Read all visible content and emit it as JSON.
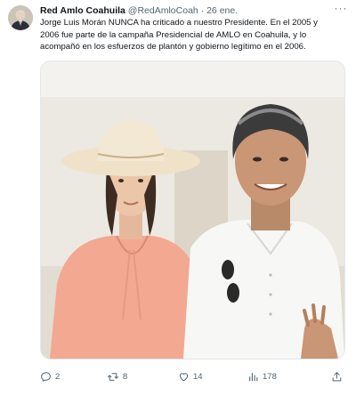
{
  "tweet": {
    "author_name": "Red Amlo Coahuila",
    "handle": "@RedAmloCoah",
    "separator": "·",
    "date": "26 ene.",
    "more_label": "···",
    "text_lines": [
      "Jorge Luis Morán NUNCA ha criticado a nuestro Presidente. En el 2005 y",
      "2006 fue parte de la campaña Presidencial de AMLO en Coahuila, y lo",
      "acompañó en los esfuerzos de plantón y gobierno legítimo en el 2006."
    ]
  },
  "actions": {
    "replies": "2",
    "retweets": "8",
    "likes": "14",
    "views": "178"
  },
  "icons": {
    "reply": "reply-icon",
    "retweet": "retweet-icon",
    "like": "heart-icon",
    "views": "views-icon",
    "share": "share-icon",
    "more": "more-icon"
  },
  "colors": {
    "text": "#0f1419",
    "muted": "#536471",
    "background": "#ffffff"
  }
}
